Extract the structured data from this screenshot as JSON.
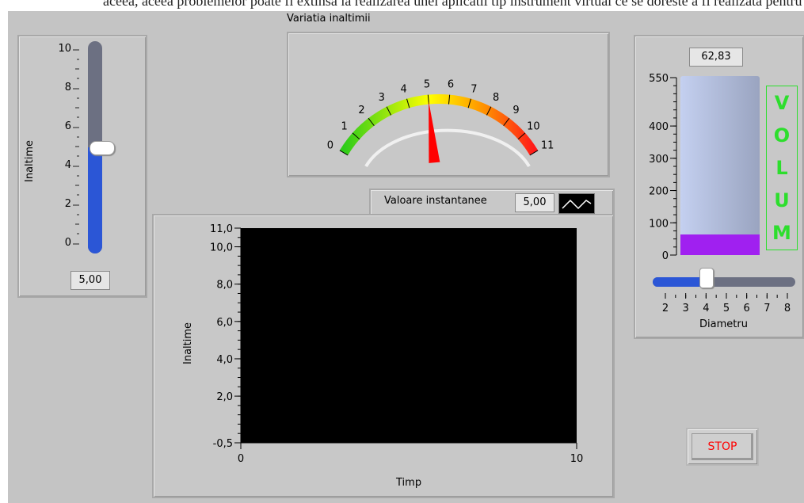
{
  "background_text": "aceea, aceea problemelor poate fi extinsa la realizarea unei aplicatii tip instrument virtual ce se doreste a fi realizata pentru masurarea inaltimii.",
  "left_slider": {
    "axis_label": "Inaltime",
    "ticks": [
      "10",
      "8",
      "6",
      "4",
      "2",
      "0"
    ],
    "value": 5.0,
    "display": "5,00",
    "colors": {
      "fill": "#2b56d6",
      "track": "#6c7082",
      "thumb": "#ffffff"
    }
  },
  "gauge": {
    "title": "Variatia inaltimii",
    "ticks": [
      "0",
      "1",
      "2",
      "3",
      "4",
      "5",
      "6",
      "7",
      "8",
      "9",
      "10",
      "11"
    ],
    "min": 0,
    "max": 11,
    "value": 5.0,
    "colors": {
      "needle": "#ff0000",
      "arc_low": "#2ecc1a",
      "arc_mid": "#ffff00",
      "arc_high": "#ff1a1a"
    }
  },
  "chart": {
    "legend_label": "Valoare instantanee",
    "legend_value": "5,00",
    "legend_icon": "line-plot-icon",
    "colors": {
      "plot_bg": "#000000",
      "frame": "#c4c4c4"
    },
    "chart_data": {
      "type": "line",
      "xlabel": "Timp",
      "ylabel": "Inaltime",
      "xlim": [
        0,
        10
      ],
      "ylim": [
        -0.5,
        11.0
      ],
      "x_ticks": [
        "0",
        "10"
      ],
      "y_ticks": [
        "11,0",
        "10,0",
        "8,0",
        "6,0",
        "4,0",
        "2,0",
        "-0,5"
      ],
      "series": []
    }
  },
  "tank": {
    "display": "62,83",
    "ticks": [
      "550",
      "400",
      "300",
      "200",
      "100",
      "0"
    ],
    "fill_value": 62.83,
    "max": 550,
    "label_letters": [
      "V",
      "O",
      "L",
      "U",
      "M"
    ],
    "colors": {
      "fill": "#a020f0",
      "glass": "#b8c4e4",
      "label": "#2dde2d"
    }
  },
  "diameter_slider": {
    "axis_label": "Diametru",
    "ticks": [
      "2",
      "3",
      "4",
      "5",
      "6",
      "7",
      "8"
    ],
    "min": 2,
    "max": 8,
    "value": 4.0
  },
  "stop_button": {
    "label": "STOP",
    "colors": {
      "text": "#ff0000"
    }
  }
}
